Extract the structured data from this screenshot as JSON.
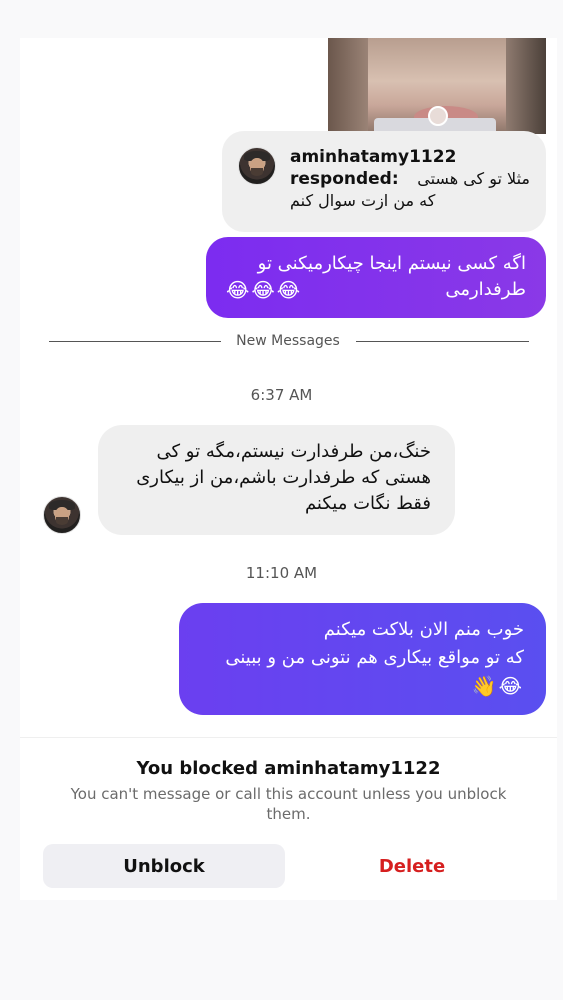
{
  "story_reply": {
    "username": "aminhatamy1122",
    "action": "responded:",
    "text_line1": "مثلا تو کی هستی",
    "text_line2": "که من ازت سوال کنم"
  },
  "messages": [
    {
      "direction": "sent",
      "lines": [
        "اگه کسی نیستم اینجا چیکارمیکنی تو",
        "طرفدارمی"
      ],
      "emoji": "😂😂😂"
    },
    {
      "direction": "received",
      "lines": [
        "خنگ،من طرفدارت نیستم،مگه تو کی",
        "هستی که طرفدارت باشم،من از بیکاری",
        "فقط نگات میکنم"
      ]
    },
    {
      "direction": "sent",
      "lines": [
        "خوب منم الان بلاکت میکنم",
        "که تو مواقع بیکاری هم نتونی من و ببینی"
      ],
      "emoji": "😂👋"
    }
  ],
  "new_messages_label": "New Messages",
  "timestamps": [
    "6:37 AM",
    "11:10 AM"
  ],
  "blocked": {
    "title": "You blocked aminhatamy1122",
    "subtitle": "You can't message or call this account unless you unblock them.",
    "unblock_label": "Unblock",
    "delete_label": "Delete"
  },
  "colors": {
    "sent_bubble_start": "#7c2cf0",
    "sent_bubble_end": "#5a4ff0",
    "received_bubble": "#efefef",
    "delete_red": "#d61f1f"
  }
}
